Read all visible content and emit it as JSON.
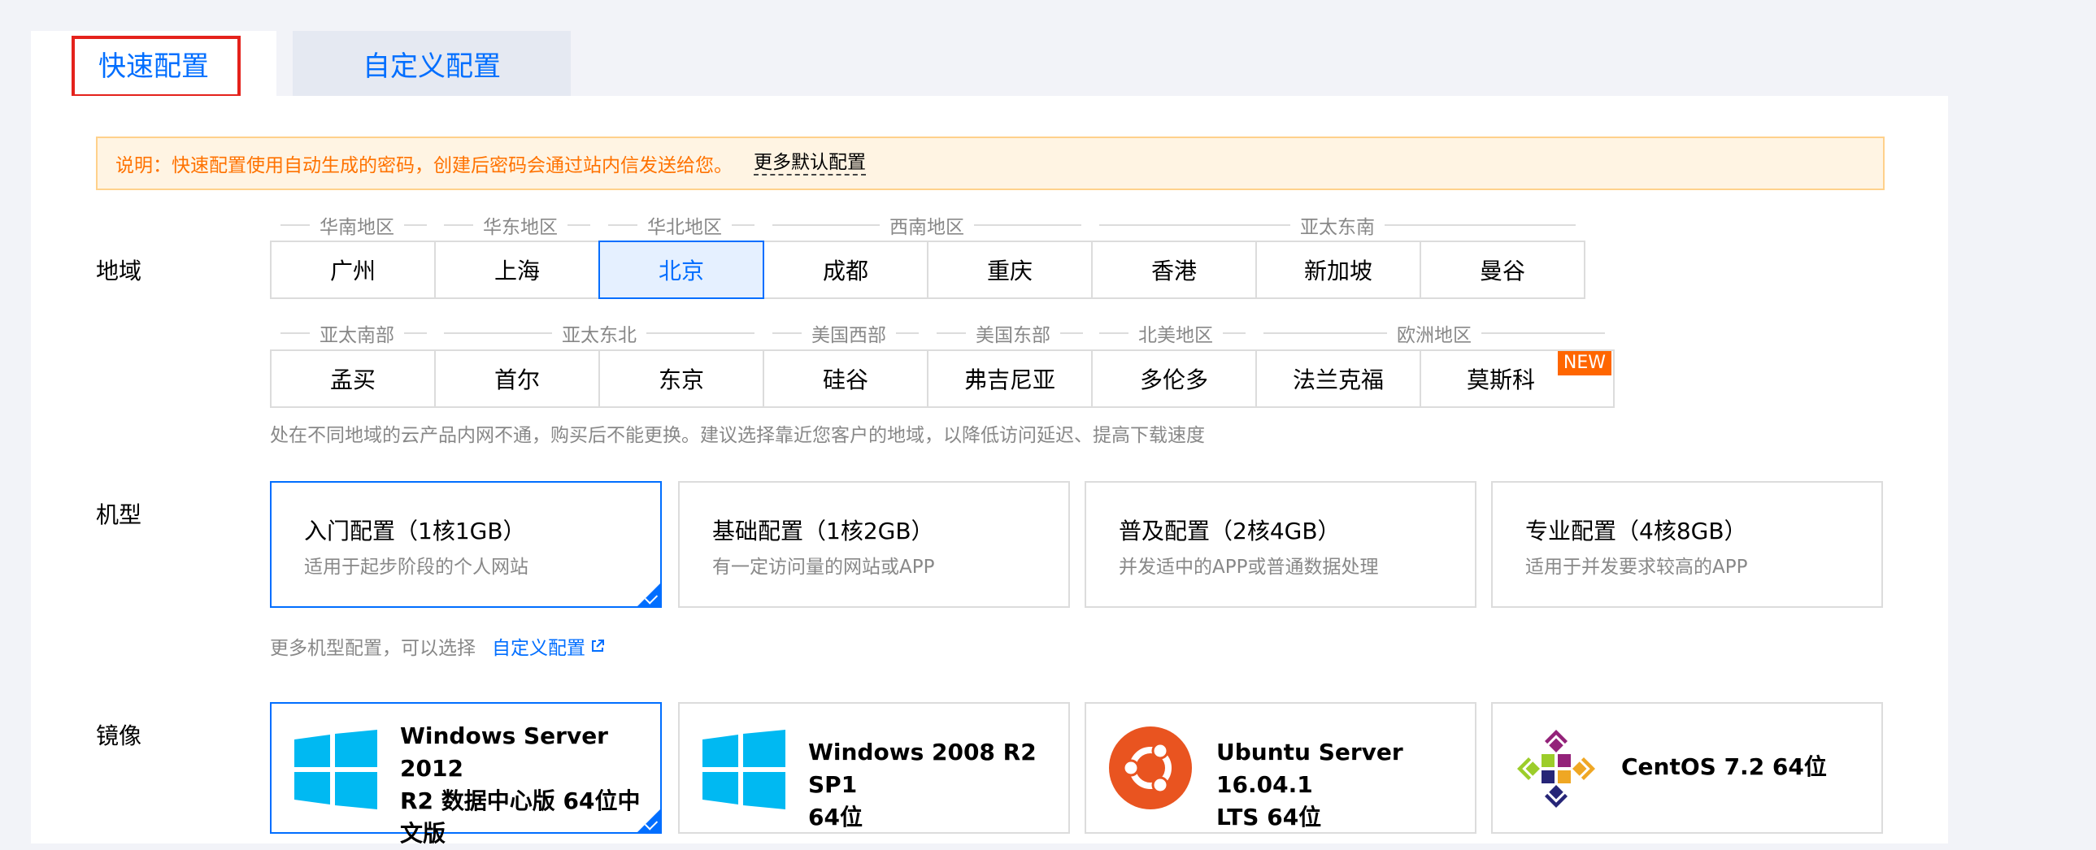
{
  "tabs": {
    "quick": "快速配置",
    "custom": "自定义配置"
  },
  "notice": {
    "text": "说明：快速配置使用自动生成的密码，创建后密码会通过站内信发送给您。",
    "more": "更多默认配置"
  },
  "region": {
    "label": "地域",
    "groups_row1": [
      "华南地区",
      "华东地区",
      "华北地区",
      "西南地区",
      "亚太东南"
    ],
    "cities_row1": [
      "广州",
      "上海",
      "北京",
      "成都",
      "重庆",
      "香港",
      "新加坡",
      "曼谷"
    ],
    "selected": "北京",
    "groups_row2": [
      "亚太南部",
      "亚太东北",
      "美国西部",
      "美国东部",
      "北美地区",
      "欧洲地区"
    ],
    "cities_row2": [
      "孟买",
      "首尔",
      "东京",
      "硅谷",
      "弗吉尼亚",
      "多伦多",
      "法兰克福",
      "莫斯科"
    ],
    "new_badge": "NEW",
    "hint": "处在不同地域的云产品内网不通，购买后不能更换。建议选择靠近您客户的地域，以降低访问延迟、提高下载速度"
  },
  "model": {
    "label": "机型",
    "cards": [
      {
        "title": "入门配置（1核1GB）",
        "desc": "适用于起步阶段的个人网站",
        "selected": true
      },
      {
        "title": "基础配置（1核2GB）",
        "desc": "有一定访问量的网站或APP",
        "selected": false
      },
      {
        "title": "普及配置（2核4GB）",
        "desc": "并发适中的APP或普通数据处理",
        "selected": false
      },
      {
        "title": "专业配置（4核8GB）",
        "desc": "适用于并发要求较高的APP",
        "selected": false
      }
    ],
    "more_text": "更多机型配置，可以选择",
    "more_link": "自定义配置"
  },
  "image": {
    "label": "镜像",
    "cards": [
      {
        "icon": "windows-icon",
        "lines": [
          "Windows Server 2012",
          "R2 数据中心版 64位中",
          "文版"
        ],
        "selected": true
      },
      {
        "icon": "windows-icon",
        "lines": [
          "Windows 2008 R2 SP1",
          "64位"
        ],
        "selected": false
      },
      {
        "icon": "ubuntu-icon",
        "lines": [
          "Ubuntu Server 16.04.1",
          "LTS 64位"
        ],
        "selected": false
      },
      {
        "icon": "centos-icon",
        "lines": [
          "CentOS 7.2 64位"
        ],
        "selected": false
      }
    ]
  },
  "colors": {
    "accent": "#006eff",
    "warning": "#ff7200",
    "badge": "#ff6600",
    "highlight": "#e4221c"
  }
}
